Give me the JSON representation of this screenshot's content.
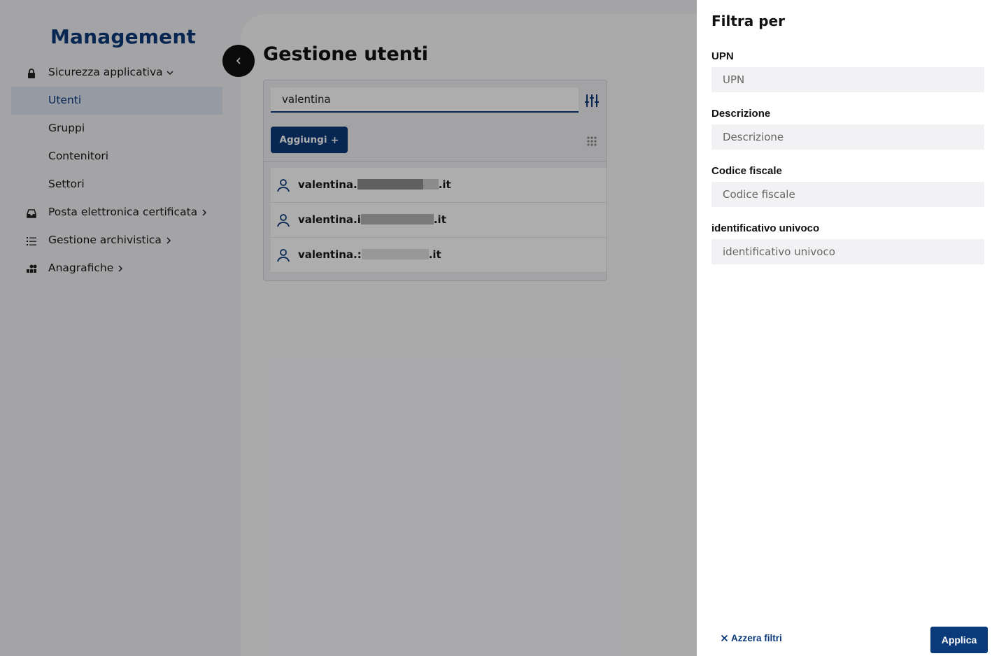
{
  "sidebar": {
    "brand": "Management",
    "items": [
      {
        "label": "Sicurezza applicativa",
        "icon": "lock-icon",
        "chevron": "down"
      },
      {
        "label": "Utenti",
        "active": true
      },
      {
        "label": "Gruppi"
      },
      {
        "label": "Contenitori"
      },
      {
        "label": "Settori"
      },
      {
        "label": "Posta elettronica certificata",
        "icon": "inbox-icon",
        "chevron": "right"
      },
      {
        "label": "Gestione archivistica",
        "icon": "list-icon",
        "chevron": "right"
      },
      {
        "label": "Anagrafiche",
        "icon": "apps-icon",
        "chevron": "right"
      }
    ]
  },
  "main": {
    "title": "Gestione utenti",
    "search": {
      "value": "valentina"
    },
    "add_button": {
      "label": "Aggiungi",
      "icon": "plus-icon"
    },
    "results": [
      {
        "prefix": "valentina.",
        "suffix": ".it"
      },
      {
        "prefix": "valentina.i",
        "suffix": ".it"
      },
      {
        "prefix": "valentina.:",
        "suffix": ".it"
      }
    ]
  },
  "drawer": {
    "title": "Filtra per",
    "fields": [
      {
        "label": "UPN",
        "placeholder": "UPN"
      },
      {
        "label": "Descrizione",
        "placeholder": "Descrizione"
      },
      {
        "label": "Codice fiscale",
        "placeholder": "Codice fiscale"
      },
      {
        "label": "identificativo univoco",
        "placeholder": "identificativo univoco"
      }
    ],
    "reset_label": "Azzera filtri",
    "apply_label": "Applica"
  },
  "colors": {
    "primary": "#0b3a7a",
    "overlay": "rgba(0,0,0,0.32)",
    "active_nav": "#dde4f0"
  }
}
